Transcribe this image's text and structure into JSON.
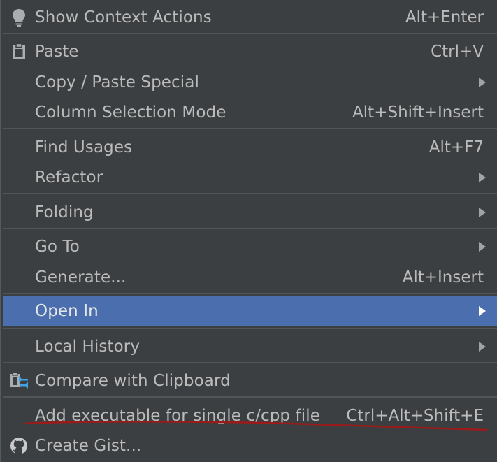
{
  "menu": {
    "items": [
      {
        "label": "Show Context Actions",
        "shortcut": "Alt+Enter",
        "icon": "lightbulb-icon"
      },
      {
        "label": "Paste",
        "shortcut": "Ctrl+V",
        "icon": "clipboard-icon"
      },
      {
        "label": "Copy / Paste Special",
        "shortcut": "",
        "submenu": true
      },
      {
        "label": "Column Selection Mode",
        "shortcut": "Alt+Shift+Insert"
      },
      {
        "label": "Find Usages",
        "shortcut": "Alt+F7"
      },
      {
        "label": "Refactor",
        "shortcut": "",
        "submenu": true
      },
      {
        "label": "Folding",
        "shortcut": "",
        "submenu": true
      },
      {
        "label": "Go To",
        "shortcut": "",
        "submenu": true
      },
      {
        "label": "Generate...",
        "shortcut": "Alt+Insert"
      },
      {
        "label": "Open In",
        "shortcut": "",
        "submenu": true,
        "selected": true
      },
      {
        "label": "Local History",
        "shortcut": "",
        "submenu": true
      },
      {
        "label": "Compare with Clipboard",
        "shortcut": "",
        "icon": "compare-clipboard-icon"
      },
      {
        "label": "Add executable for single c/cpp file",
        "shortcut": "Ctrl+Alt+Shift+E"
      },
      {
        "label": "Create Gist...",
        "shortcut": "",
        "icon": "github-icon"
      }
    ]
  },
  "colors": {
    "background": "#3c3f41",
    "selection": "#4b6eaf",
    "text": "#bbbbbb",
    "separator": "#515558",
    "annotation_underline": "#9b1b1b"
  }
}
